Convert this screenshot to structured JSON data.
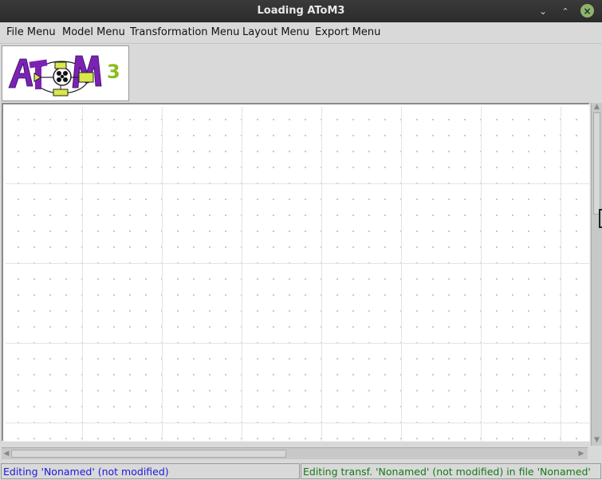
{
  "window": {
    "title": "Loading AToM3"
  },
  "window_controls": {
    "minimize_glyph": "⌄",
    "maximize_glyph": "⌃",
    "close_glyph": "×"
  },
  "menubar": {
    "items": [
      {
        "label": "File Menu"
      },
      {
        "label": "Model Menu"
      },
      {
        "label": "Transformation Menu"
      },
      {
        "label": "Layout Menu"
      },
      {
        "label": "Export Menu"
      }
    ]
  },
  "logo": {
    "text": "AToM3",
    "colors": {
      "letters": "#7b22b5",
      "accent": "#8bbd1a",
      "ribbon": "#d8e84a"
    }
  },
  "scrollbars": {
    "up_arrow": "▲",
    "down_arrow": "▼",
    "left_arrow": "◀",
    "right_arrow": "▶"
  },
  "status": {
    "left": "Editing 'Nonamed' (not modified)",
    "right": "Editing transf. 'Nonamed' (not modified) in file 'Nonamed'",
    "left_color": "#1a1adc",
    "right_color": "#157a15"
  }
}
